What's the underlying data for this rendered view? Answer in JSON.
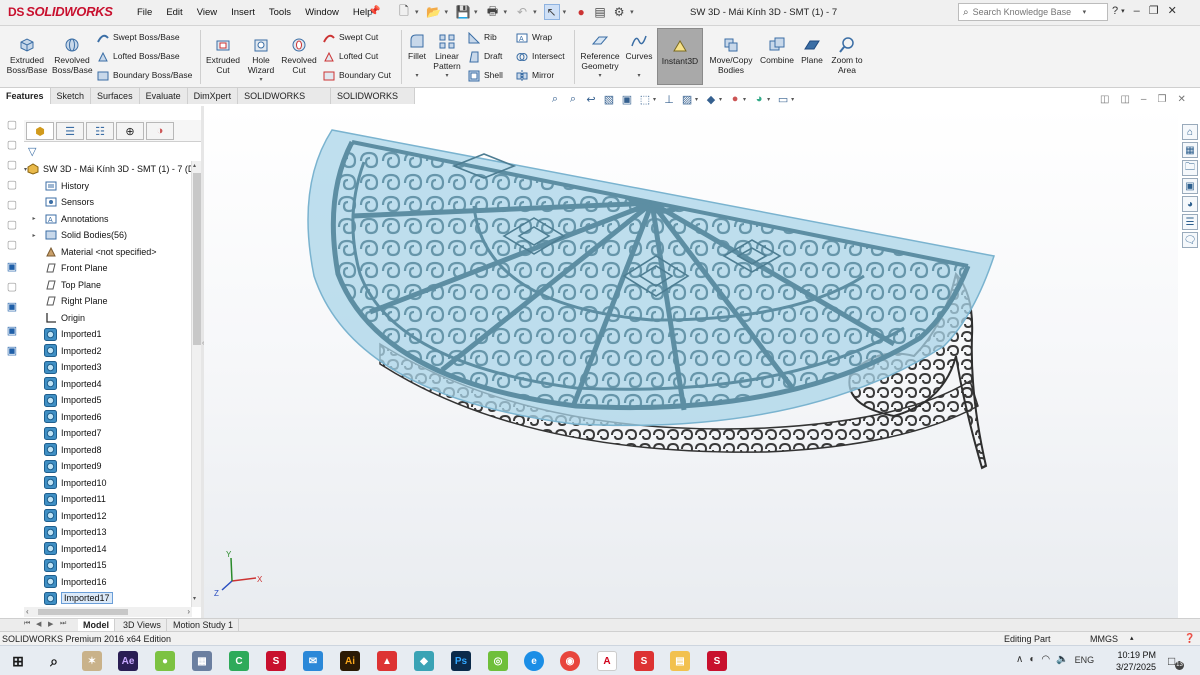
{
  "app": {
    "logo_ds": "DS",
    "logo_text": "SOLIDWORKS",
    "document_title": "SW 3D - Mái Kính 3D - SMT (1) - 7"
  },
  "menu": [
    "File",
    "Edit",
    "View",
    "Insert",
    "Tools",
    "Window",
    "Help"
  ],
  "search": {
    "placeholder": "Search Knowledge Base"
  },
  "features_toolbar": {
    "extruded_boss": "Extruded Boss/Base",
    "revolved_boss": "Revolved Boss/Base",
    "swept_boss": "Swept Boss/Base",
    "lofted_boss": "Lofted Boss/Base",
    "boundary_boss": "Boundary Boss/Base",
    "extruded_cut": "Extruded Cut",
    "hole_wizard": "Hole Wizard",
    "revolved_cut": "Revolved Cut",
    "swept_cut": "Swept Cut",
    "lofted_cut": "Lofted Cut",
    "boundary_cut": "Boundary Cut",
    "fillet": "Fillet",
    "linear_pattern": "Linear Pattern",
    "rib": "Rib",
    "draft": "Draft",
    "shell": "Shell",
    "wrap": "Wrap",
    "intersect": "Intersect",
    "mirror": "Mirror",
    "reference_geometry": "Reference Geometry",
    "curves": "Curves",
    "instant3d": "Instant3D",
    "move_copy": "Move/Copy Bodies",
    "combine": "Combine",
    "plane": "Plane",
    "zoom_to_area": "Zoom to Area"
  },
  "command_tabs": [
    "Features",
    "Sketch",
    "Surfaces",
    "Evaluate",
    "DimXpert",
    "SOLIDWORKS Add-Ins",
    "SOLIDWORKS MBD"
  ],
  "tree": {
    "root": "SW 3D - Mái Kính 3D - SMT (1) - 7  (D",
    "items": [
      {
        "label": "History"
      },
      {
        "label": "Sensors"
      },
      {
        "label": "Annotations"
      },
      {
        "label": "Solid Bodies(56)"
      },
      {
        "label": "Material <not specified>"
      },
      {
        "label": "Front Plane"
      },
      {
        "label": "Top Plane"
      },
      {
        "label": "Right Plane"
      },
      {
        "label": "Origin"
      },
      {
        "label": "Imported1"
      },
      {
        "label": "Imported2"
      },
      {
        "label": "Imported3"
      },
      {
        "label": "Imported4"
      },
      {
        "label": "Imported5"
      },
      {
        "label": "Imported6"
      },
      {
        "label": "Imported7"
      },
      {
        "label": "Imported8"
      },
      {
        "label": "Imported9"
      },
      {
        "label": "Imported10"
      },
      {
        "label": "Imported11"
      },
      {
        "label": "Imported12"
      },
      {
        "label": "Imported13"
      },
      {
        "label": "Imported14"
      },
      {
        "label": "Imported15"
      },
      {
        "label": "Imported16"
      },
      {
        "label": "Imported17"
      }
    ]
  },
  "triad": {
    "x": "X",
    "y": "Y",
    "z": "Z"
  },
  "bottom_tabs": [
    "Model",
    "3D Views",
    "Motion Study 1"
  ],
  "status": {
    "edition": "SOLIDWORKS Premium 2016 x64 Edition",
    "mode": "Editing Part",
    "units": "MMGS"
  },
  "taskbar": {
    "lang": "ENG",
    "time": "10:19 PM",
    "date": "3/27/2025",
    "notifications": "13"
  },
  "colors": {
    "glass": "#a9d4e8",
    "iron_blue": "#5d8ea3",
    "iron_dark": "#3a3a3a",
    "brand_red": "#c8102e"
  }
}
